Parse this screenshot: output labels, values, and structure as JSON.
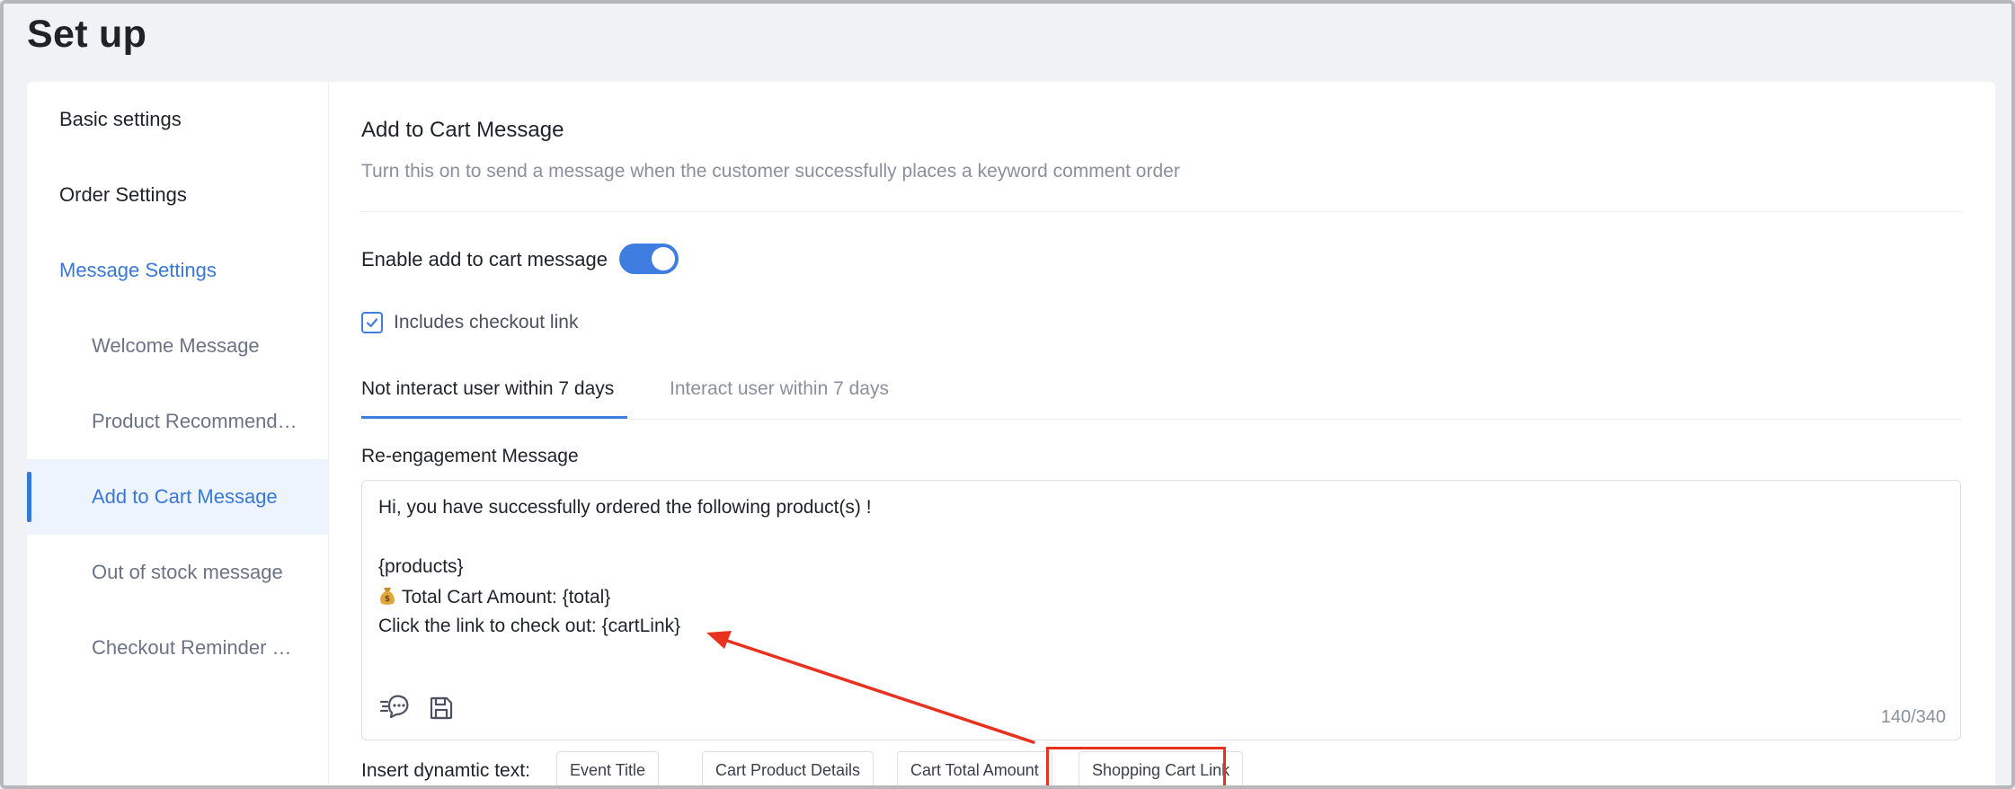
{
  "page": {
    "title": "Set up"
  },
  "sidebar": {
    "items": [
      {
        "label": "Basic settings"
      },
      {
        "label": "Order Settings"
      },
      {
        "label": "Message Settings"
      },
      {
        "label": "Welcome Message"
      },
      {
        "label": "Product Recommendations"
      },
      {
        "label": "Add to Cart Message"
      },
      {
        "label": "Out of stock message"
      },
      {
        "label": "Checkout Reminder Message"
      }
    ]
  },
  "main": {
    "title": "Add to Cart Message",
    "description": "Turn this on to send a message when the customer successfully places a keyword comment order",
    "enable_label": "Enable add to cart message",
    "checkout_label": "Includes checkout link",
    "tabs": [
      {
        "label": "Not interact user within 7 days"
      },
      {
        "label": "Interact user within 7 days"
      }
    ],
    "field_label": "Re-engagement Message",
    "message_lines": [
      "Hi, you have successfully ordered the following product(s) !",
      "{products}",
      "Total Cart Amount: {total}",
      "Click the link to check out: {cartLink}"
    ],
    "counter": "140/340",
    "insert_label": "Insert dynamtic text:",
    "chips": [
      {
        "label": "Event Title"
      },
      {
        "label": "Cart Product Details"
      },
      {
        "label": "Cart Total Amount"
      },
      {
        "label": "Shopping Cart Link"
      }
    ]
  },
  "colors": {
    "accent": "#3f7de0",
    "annotation": "#e8321f"
  }
}
